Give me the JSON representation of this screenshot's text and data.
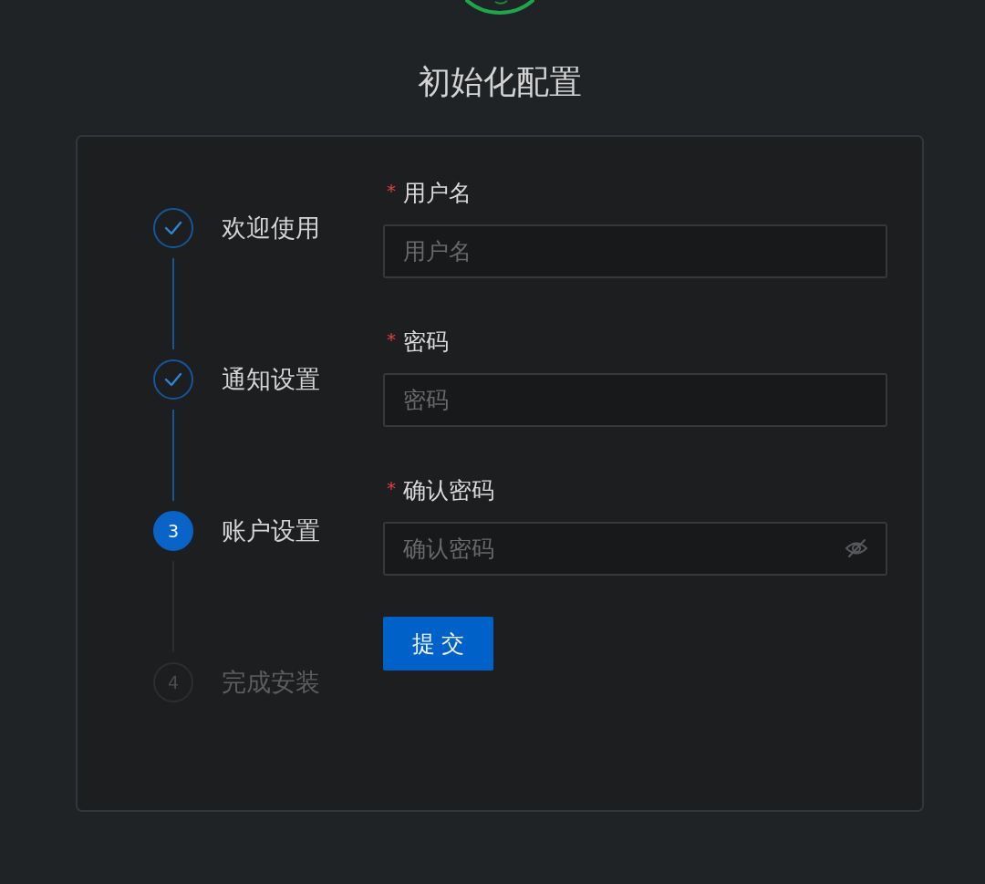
{
  "title": "初始化配置",
  "steps": [
    {
      "label": "欢迎使用",
      "done": true,
      "active": false
    },
    {
      "label": "通知设置",
      "done": true,
      "active": false
    },
    {
      "label": "账户设置",
      "done": false,
      "active": true,
      "number": "3"
    },
    {
      "label": "完成安装",
      "done": false,
      "active": false,
      "number": "4"
    }
  ],
  "form": {
    "fields": [
      {
        "required_mark": "*",
        "label": "用户名",
        "placeholder": "用户名",
        "visibility_toggle": false
      },
      {
        "required_mark": "*",
        "label": "密码",
        "placeholder": "密码",
        "visibility_toggle": false
      },
      {
        "required_mark": "*",
        "label": "确认密码",
        "placeholder": "确认密码",
        "visibility_toggle": true
      }
    ],
    "submit_button": {
      "label": "提 交"
    }
  }
}
